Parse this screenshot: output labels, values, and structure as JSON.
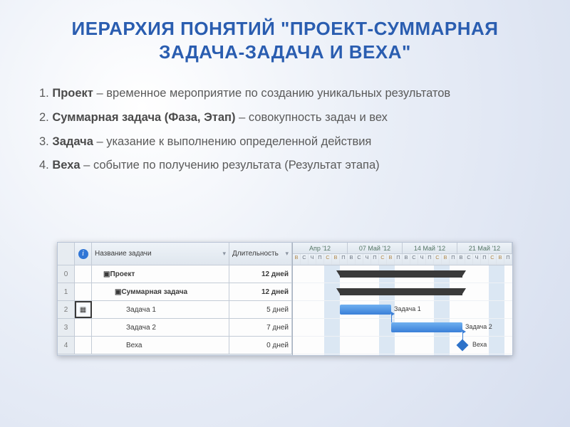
{
  "title": "ИЕРАРХИЯ ПОНЯТИЙ \"ПРОЕКТ-СУММАРНАЯ ЗАДАЧА-ЗАДАЧА И ВЕХА\"",
  "defs": [
    {
      "n": "1.",
      "term": "Проект",
      "rest": " – временное мероприятие по созданию уникальных результатов"
    },
    {
      "n": "2.",
      "term": "Суммарная задача (Фаза, Этап)",
      "rest": " – совокупность задач и вех"
    },
    {
      "n": "3.",
      "term": "Задача",
      "rest": " – указание к выполнению определенной действия"
    },
    {
      "n": "4.",
      "term": "Веха",
      "rest": " – событие по получению результата (Результат этапа)"
    }
  ],
  "table": {
    "headers": {
      "info": "i",
      "name": "Название задачи",
      "dur": "Длительность"
    },
    "rows": [
      {
        "idx": "0",
        "name": "Проект",
        "dur": "12 дней",
        "summary": true,
        "indent": 1,
        "sel": false
      },
      {
        "idx": "1",
        "name": "Суммарная задача",
        "dur": "12 дней",
        "summary": true,
        "indent": 2,
        "sel": false
      },
      {
        "idx": "2",
        "name": "Задача 1",
        "dur": "5 дней",
        "summary": false,
        "indent": 3,
        "sel": true
      },
      {
        "idx": "3",
        "name": "Задача 2",
        "dur": "7 дней",
        "summary": false,
        "indent": 3,
        "sel": false
      },
      {
        "idx": "4",
        "name": "Веха",
        "dur": "0 дней",
        "summary": false,
        "indent": 3,
        "sel": false
      }
    ]
  },
  "timeline": {
    "weeks": [
      "Апр '12",
      "07 Май '12",
      "14 Май '12",
      "21 Май '12"
    ],
    "day_labels": [
      "В",
      "С",
      "Ч",
      "П",
      "С",
      "В",
      "П"
    ]
  },
  "gantt": {
    "bars": {
      "task1": {
        "label": "Задача 1"
      },
      "task2": {
        "label": "Задача 2"
      },
      "milestone": {
        "label": "Веха"
      }
    }
  }
}
